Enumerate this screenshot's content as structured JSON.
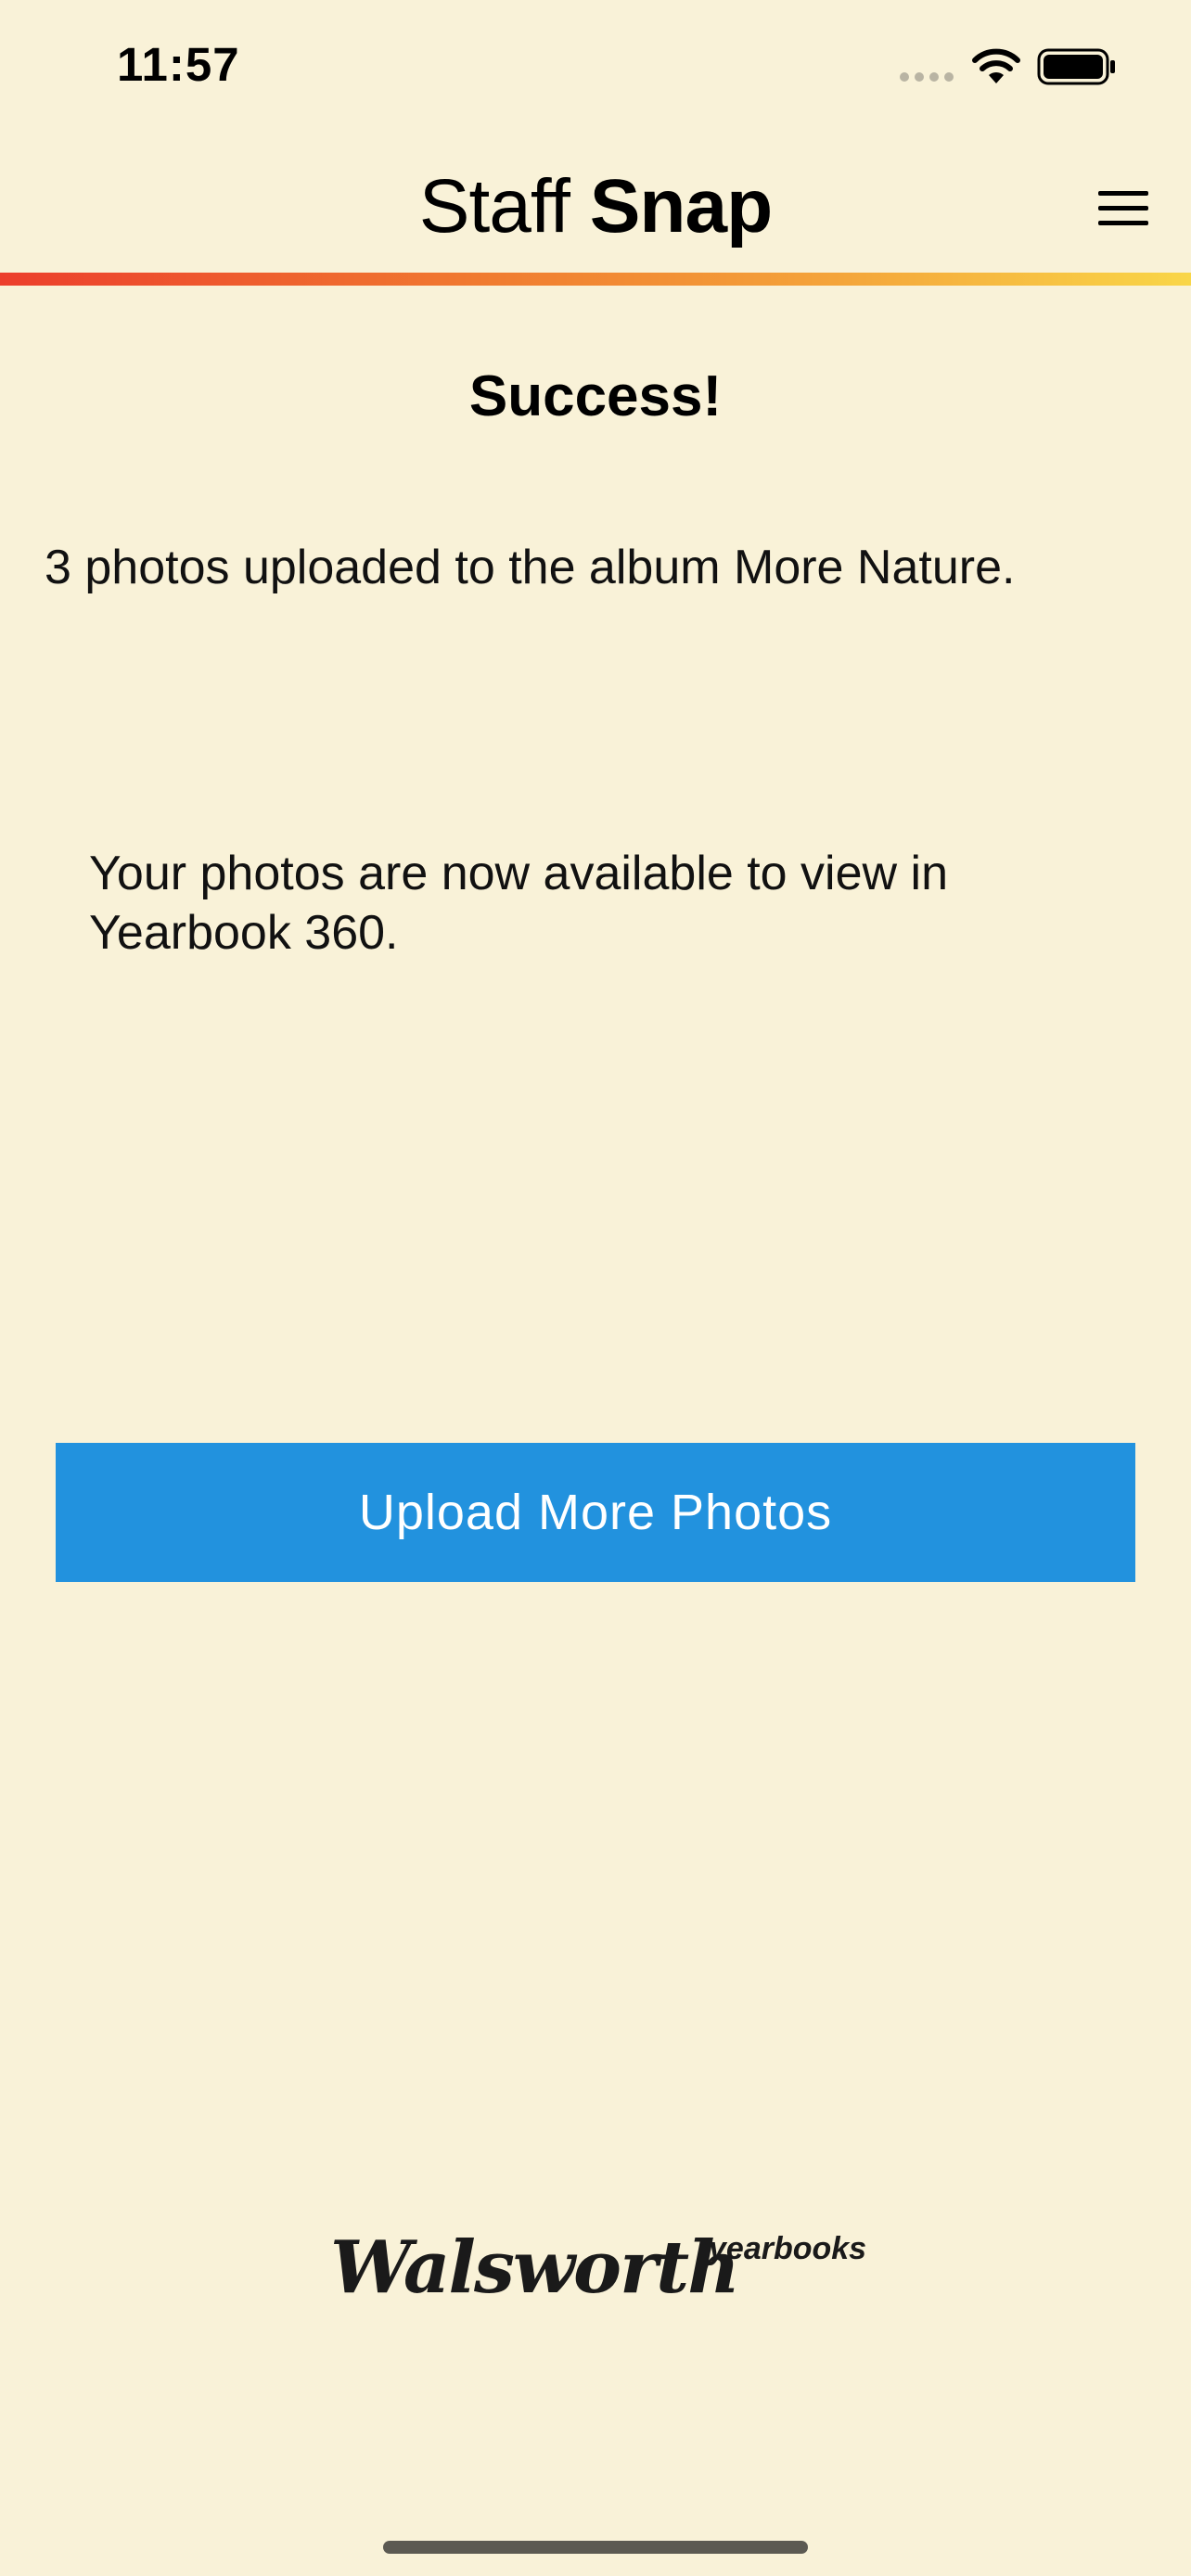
{
  "status_bar": {
    "time": "11:57"
  },
  "header": {
    "logo_light": "Staff ",
    "logo_bold": "Snap",
    "menu_icon": "hamburger-menu-icon"
  },
  "content": {
    "title": "Success!",
    "upload_message": "3 photos uploaded to the album More Nature.",
    "availability_message": "Your photos are now available to view in Yearbook 360.",
    "upload_more_label": "Upload More Photos"
  },
  "footer": {
    "brand_name": "Walsworth",
    "brand_suffix": "yearbooks"
  },
  "colors": {
    "background": "#f9f2d8",
    "accent_button": "#2292de",
    "gradient_start": "#ec3e2c",
    "gradient_end": "#f9d648"
  }
}
